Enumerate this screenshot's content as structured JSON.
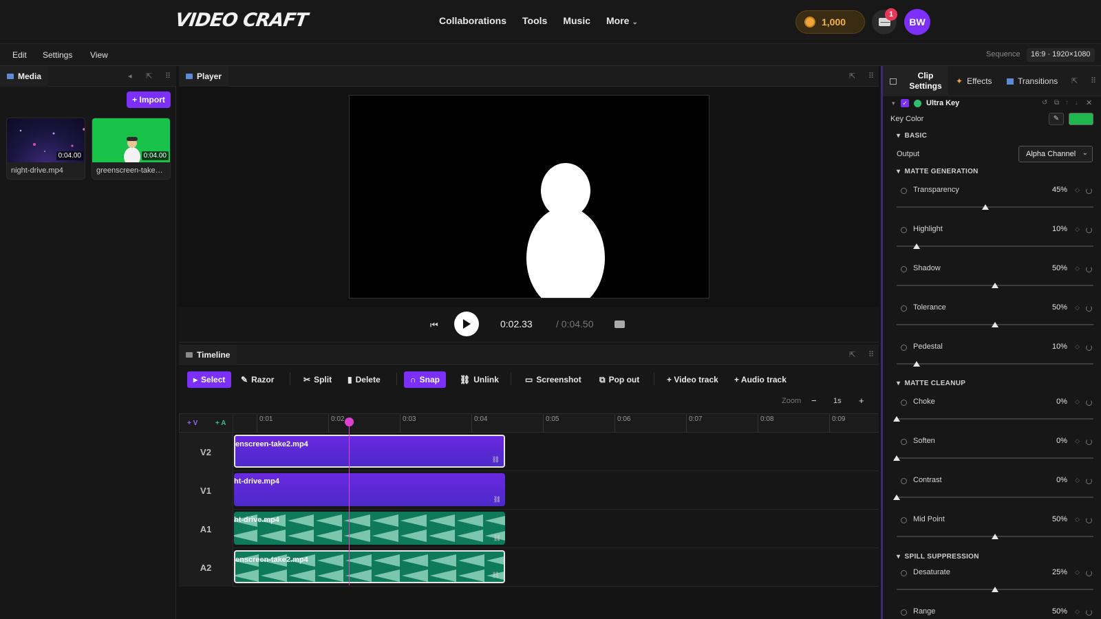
{
  "app": {
    "logo": "VIDEO CRAFT",
    "nav": [
      "Collaborations",
      "Tools",
      "Music",
      "More"
    ],
    "coins": "1,000",
    "notifications": "1",
    "avatar": "BW"
  },
  "menubar": {
    "items": [
      "Edit",
      "Settings",
      "View"
    ],
    "sequence_label": "Sequence",
    "sequence_value": "16:9 · 1920×1080"
  },
  "media": {
    "tab": "Media",
    "import_label": "+ Import",
    "items": [
      {
        "name": "night-drive.mp4",
        "duration": "0:04.00"
      },
      {
        "name": "greenscreen-take…",
        "duration": "0:04.00"
      }
    ]
  },
  "player": {
    "tab": "Player",
    "current_time": "0:02.33",
    "total_time": "/ 0:04.50"
  },
  "timeline": {
    "tab": "Timeline",
    "tools": [
      "Select",
      "Razor",
      "Split",
      "Delete",
      "Snap",
      "Unlink",
      "Screenshot",
      "Pop out",
      "+ Video track",
      "+ Audio track"
    ],
    "zoom_label": "Zoom",
    "zoom_minus": "−",
    "zoom_value": "1s",
    "zoom_plus": "+",
    "add_video": "+ V",
    "add_audio": "+ A",
    "ruler": [
      "0:01",
      "0:02",
      "0:03",
      "0:04",
      "0:05",
      "0:06",
      "0:07",
      "0:08",
      "0:09"
    ],
    "tracks": [
      {
        "label": "V2",
        "clip": "enscreen-take2.mp4"
      },
      {
        "label": "V1",
        "clip": "ht-drive.mp4"
      },
      {
        "label": "A1",
        "clip": "ht-drive.mp4"
      },
      {
        "label": "A2",
        "clip": "enscreen-take2.mp4"
      }
    ]
  },
  "panel": {
    "tabs": [
      "Clip Settings",
      "Effects",
      "Transitions"
    ],
    "effect_name": "Ultra Key",
    "key_color_label": "Key Color",
    "key_color": "#1fb84c",
    "sections": {
      "basic": "BASIC",
      "matte_generation": "MATTE GENERATION",
      "matte_cleanup": "MATTE CLEANUP",
      "spill_suppression": "SPILL SUPPRESSION"
    },
    "output_label": "Output",
    "output_value": "Alpha Channel",
    "params": [
      {
        "name": "Transparency",
        "value": "45%",
        "level": 0.45
      },
      {
        "name": "Highlight",
        "value": "10%",
        "level": 0.1
      },
      {
        "name": "Shadow",
        "value": "50%",
        "level": 0.5
      },
      {
        "name": "Tolerance",
        "value": "50%",
        "level": 0.5
      },
      {
        "name": "Pedestal",
        "value": "10%",
        "level": 0.1
      },
      {
        "name": "Choke",
        "value": "0%",
        "level": 0.0
      },
      {
        "name": "Soften",
        "value": "0%",
        "level": 0.0
      },
      {
        "name": "Contrast",
        "value": "0%",
        "level": 0.0
      },
      {
        "name": "Mid Point",
        "value": "50%",
        "level": 0.5
      },
      {
        "name": "Desaturate",
        "value": "25%",
        "level": 0.5
      },
      {
        "name": "Range",
        "value": "50%",
        "level": 0.5
      }
    ]
  },
  "colors": {
    "accent": "#7b2ff7",
    "playhead": "#e040d0",
    "video_clip": "#5b2ad6",
    "audio_clip": "#0f7a5a"
  }
}
